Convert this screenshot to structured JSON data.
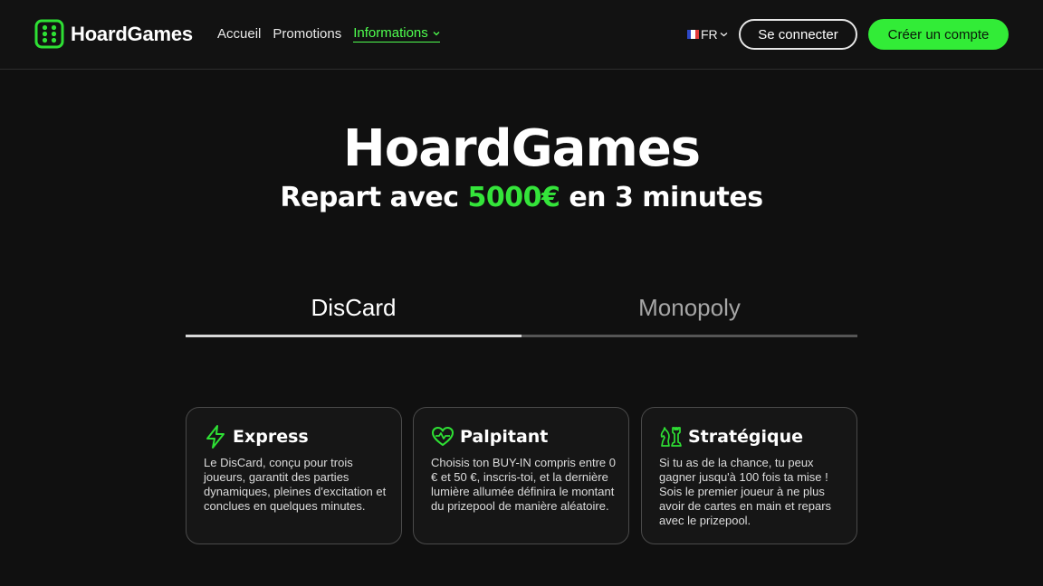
{
  "header": {
    "brand": "HoardGames",
    "nav": [
      "Accueil",
      "Promotions",
      "Informations"
    ],
    "lang": "FR",
    "login_label": "Se connecter",
    "signup_label": "Créer un compte"
  },
  "hero": {
    "title": "HoardGames",
    "sub_prefix": "Repart avec ",
    "sub_amount": "5000€",
    "sub_suffix": " en 3 minutes"
  },
  "tabs": [
    "DisCard",
    "Monopoly"
  ],
  "cards": [
    {
      "icon": "lightning-icon",
      "title": "Express",
      "text": "Le DisCard, conçu pour trois joueurs, garantit des parties dynamiques, pleines d'excitation et conclues en quelques minutes."
    },
    {
      "icon": "heartbeat-icon",
      "title": "Palpitant",
      "text": "Choisis ton BUY-IN compris entre 0 € et 50 €, inscris-toi, et la dernière lumière allumée définira le montant du prizepool de manière aléatoire."
    },
    {
      "icon": "chess-icon",
      "title": "Stratégique",
      "text": "Si tu as de la chance, tu peux gagner jusqu'à 100 fois ta mise ! Sois le premier joueur à ne plus avoir de cartes en main et repars avec le prizepool."
    }
  ],
  "colors": {
    "accent": "#32ec37",
    "background": "#101010"
  }
}
